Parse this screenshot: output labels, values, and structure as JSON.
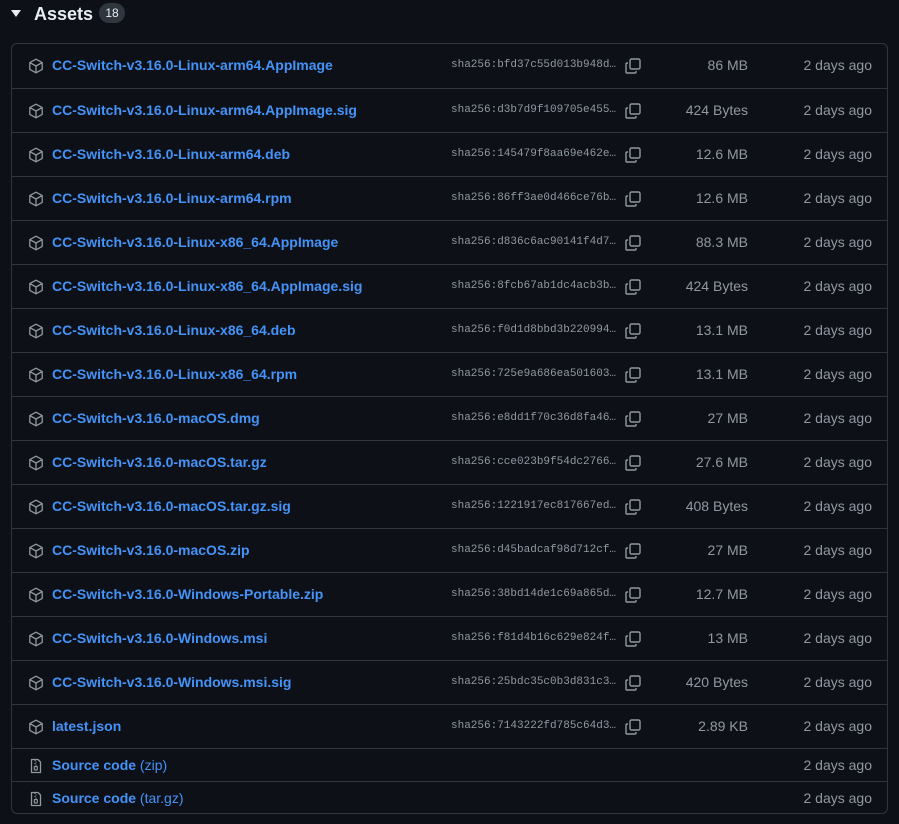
{
  "header": {
    "title": "Assets",
    "count": "18",
    "toggle_icon": "triangle-down-icon"
  },
  "assets": [
    {
      "name": "CC-Switch-v3.16.0-Linux-arm64.AppImage",
      "sha": "sha256:bfd37c55d013b948d…",
      "size": "86 MB",
      "date": "2 days ago"
    },
    {
      "name": "CC-Switch-v3.16.0-Linux-arm64.AppImage.sig",
      "sha": "sha256:d3b7d9f109705e455…",
      "size": "424 Bytes",
      "date": "2 days ago"
    },
    {
      "name": "CC-Switch-v3.16.0-Linux-arm64.deb",
      "sha": "sha256:145479f8aa69e462e…",
      "size": "12.6 MB",
      "date": "2 days ago"
    },
    {
      "name": "CC-Switch-v3.16.0-Linux-arm64.rpm",
      "sha": "sha256:86ff3ae0d466ce76b…",
      "size": "12.6 MB",
      "date": "2 days ago"
    },
    {
      "name": "CC-Switch-v3.16.0-Linux-x86_64.AppImage",
      "sha": "sha256:d836c6ac90141f4d7…",
      "size": "88.3 MB",
      "date": "2 days ago"
    },
    {
      "name": "CC-Switch-v3.16.0-Linux-x86_64.AppImage.sig",
      "sha": "sha256:8fcb67ab1dc4acb3b…",
      "size": "424 Bytes",
      "date": "2 days ago"
    },
    {
      "name": "CC-Switch-v3.16.0-Linux-x86_64.deb",
      "sha": "sha256:f0d1d8bbd3b220994…",
      "size": "13.1 MB",
      "date": "2 days ago"
    },
    {
      "name": "CC-Switch-v3.16.0-Linux-x86_64.rpm",
      "sha": "sha256:725e9a686ea501603…",
      "size": "13.1 MB",
      "date": "2 days ago"
    },
    {
      "name": "CC-Switch-v3.16.0-macOS.dmg",
      "sha": "sha256:e8dd1f70c36d8fa46…",
      "size": "27 MB",
      "date": "2 days ago"
    },
    {
      "name": "CC-Switch-v3.16.0-macOS.tar.gz",
      "sha": "sha256:cce023b9f54dc2766…",
      "size": "27.6 MB",
      "date": "2 days ago"
    },
    {
      "name": "CC-Switch-v3.16.0-macOS.tar.gz.sig",
      "sha": "sha256:1221917ec817667ed…",
      "size": "408 Bytes",
      "date": "2 days ago"
    },
    {
      "name": "CC-Switch-v3.16.0-macOS.zip",
      "sha": "sha256:d45badcaf98d712cf…",
      "size": "27 MB",
      "date": "2 days ago"
    },
    {
      "name": "CC-Switch-v3.16.0-Windows-Portable.zip",
      "sha": "sha256:38bd14de1c69a865d…",
      "size": "12.7 MB",
      "date": "2 days ago"
    },
    {
      "name": "CC-Switch-v3.16.0-Windows.msi",
      "sha": "sha256:f81d4b16c629e824f…",
      "size": "13 MB",
      "date": "2 days ago"
    },
    {
      "name": "CC-Switch-v3.16.0-Windows.msi.sig",
      "sha": "sha256:25bdc35c0b3d831c3…",
      "size": "420 Bytes",
      "date": "2 days ago"
    },
    {
      "name": "latest.json",
      "sha": "sha256:7143222fd785c64d3…",
      "size": "2.89 KB",
      "date": "2 days ago"
    }
  ],
  "source": [
    {
      "label": "Source code",
      "ext": "(zip)",
      "date": "2 days ago"
    },
    {
      "label": "Source code",
      "ext": "(tar.gz)",
      "date": "2 days ago"
    }
  ],
  "icons": {
    "asset": "package-icon",
    "source": "file-zip-icon",
    "copy": "copy-icon"
  },
  "colors": {
    "background": "#0d1117",
    "border": "#30363d",
    "link": "#4493f8",
    "muted": "#9198a1",
    "text": "#e6edf3"
  }
}
